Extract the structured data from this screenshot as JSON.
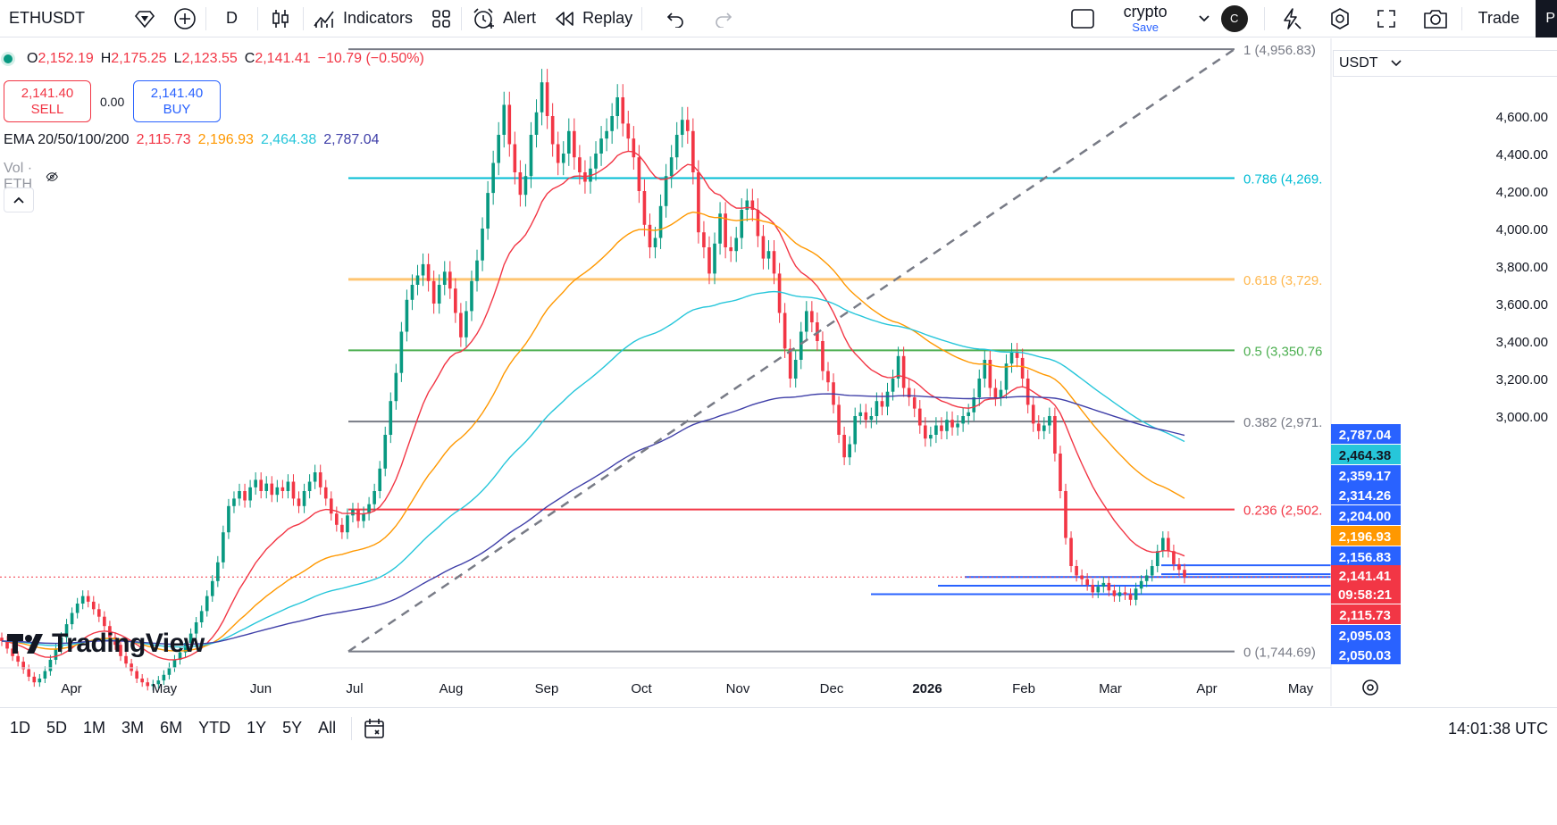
{
  "toolbar": {
    "symbol": "ETHUSDT",
    "interval": "D",
    "indicators_label": "Indicators",
    "alert_label": "Alert",
    "replay_label": "Replay",
    "workspace_name": "crypto",
    "workspace_save": "Save",
    "avatar_letter": "C",
    "trade_label": "Trade",
    "p_label": "P"
  },
  "legend": {
    "open_key": "O",
    "open": "2,152.19",
    "high_key": "H",
    "high": "2,175.25",
    "low_key": "L",
    "low": "2,123.55",
    "close_key": "C",
    "close": "2,141.41",
    "change": "−10.79 (−0.50%)",
    "sell_price": "2,141.40",
    "sell_label": "SELL",
    "spread": "0.00",
    "buy_price": "2,141.40",
    "buy_label": "BUY",
    "ema_label": "EMA 20/50/100/200",
    "ema_values": [
      "2,115.73",
      "2,196.93",
      "2,464.38",
      "2,787.04"
    ],
    "vol_label": "Vol · ETH"
  },
  "currency": "USDT",
  "logo_text": "TradingView",
  "bottombar": {
    "ranges": [
      "1D",
      "5D",
      "1M",
      "3M",
      "6M",
      "YTD",
      "1Y",
      "5Y",
      "All"
    ],
    "time": "14:01:38 UTC"
  },
  "colors": {
    "ema20": "#f23645",
    "ema50": "#ff9800",
    "ema100": "#26c6da",
    "ema200": "#3f3fa8",
    "up": "#089981",
    "down": "#f23645",
    "fib_0": "#787b86",
    "fib_236": "#f23645",
    "fib_382": "#787b86",
    "fib_5": "#4caf50",
    "fib_618": "#ffb74d",
    "fib_786": "#00bcd4",
    "fib_1": "#787b86",
    "hline": "#2962ff"
  },
  "chart_data": {
    "type": "candlestick",
    "symbol": "ETHUSDT",
    "interval": "1D",
    "price_ticks": [
      "4,600.00",
      "4,400.00",
      "4,200.00",
      "4,000.00",
      "3,800.00",
      "3,600.00",
      "3,400.00",
      "3,200.00",
      "3,000.00"
    ],
    "time_ticks": [
      "Apr",
      "May",
      "Jun",
      "Jul",
      "Aug",
      "Sep",
      "Oct",
      "Nov",
      "Dec",
      "2026",
      "Feb",
      "Mar",
      "Apr",
      "May"
    ],
    "fib_levels": [
      {
        "level": 1,
        "price": 4956.83,
        "label": "1 (4,956.83)"
      },
      {
        "level": 0.786,
        "price": 4269,
        "label": "0.786 (4,269."
      },
      {
        "level": 0.618,
        "price": 3729,
        "label": "0.618 (3,729."
      },
      {
        "level": 0.5,
        "price": 3350.76,
        "label": "0.5 (3,350.76"
      },
      {
        "level": 0.382,
        "price": 2971,
        "label": "0.382 (2,971."
      },
      {
        "level": 0.236,
        "price": 2502,
        "label": "0.236 (2,502."
      },
      {
        "level": 0,
        "price": 1744.69,
        "label": "0 (1,744.69)"
      }
    ],
    "price_labels": [
      {
        "price": 2787.04,
        "text": "2,787.04",
        "color": "#2962ff"
      },
      {
        "price": 2464.38,
        "text": "2,464.38",
        "color": "#26c6da"
      },
      {
        "price": 2359.17,
        "text": "2,359.17",
        "color": "#2962ff"
      },
      {
        "price": 2314.26,
        "text": "2,314.26",
        "color": "#2962ff"
      },
      {
        "price": 2204.0,
        "text": "2,204.00",
        "color": "#2962ff"
      },
      {
        "price": 2196.93,
        "text": "2,196.93",
        "color": "#ff9800"
      },
      {
        "price": 2156.83,
        "text": "2,156.83",
        "color": "#2962ff"
      },
      {
        "price": 2141.41,
        "text": "2,141.41",
        "color": "#f23645"
      },
      {
        "price": 2141.41,
        "text": "09:58:21",
        "color": "#f23645"
      },
      {
        "price": 2115.73,
        "text": "2,115.73",
        "color": "#f23645"
      },
      {
        "price": 2095.03,
        "text": "2,095.03",
        "color": "#2962ff"
      },
      {
        "price": 2050.03,
        "text": "2,050.03",
        "color": "#2962ff"
      }
    ],
    "horizontal_lines": [
      2204.0,
      2156.83,
      2141.41,
      2095.03,
      2050.03
    ],
    "ema_series": [
      {
        "name": "EMA 20",
        "last": 2115.73
      },
      {
        "name": "EMA 50",
        "last": 2196.93
      },
      {
        "name": "EMA 100",
        "last": 2464.38
      },
      {
        "name": "EMA 200",
        "last": 2787.04
      }
    ],
    "candles_close": [
      1800,
      1760,
      1720,
      1690,
      1650,
      1610,
      1580,
      1600,
      1640,
      1700,
      1760,
      1820,
      1890,
      1950,
      2000,
      2040,
      2010,
      1970,
      1930,
      1880,
      1820,
      1780,
      1720,
      1680,
      1640,
      1600,
      1580,
      1560,
      1570,
      1590,
      1620,
      1660,
      1700,
      1740,
      1790,
      1840,
      1900,
      1960,
      2040,
      2120,
      2220,
      2380,
      2520,
      2560,
      2600,
      2550,
      2620,
      2660,
      2600,
      2640,
      2580,
      2620,
      2600,
      2650,
      2560,
      2520,
      2600,
      2650,
      2700,
      2620,
      2560,
      2480,
      2420,
      2380,
      2470,
      2500,
      2440,
      2480,
      2530,
      2600,
      2720,
      2900,
      3080,
      3230,
      3450,
      3620,
      3700,
      3750,
      3810,
      3720,
      3600,
      3700,
      3770,
      3680,
      3550,
      3420,
      3560,
      3720,
      3830,
      4000,
      4190,
      4350,
      4500,
      4660,
      4450,
      4300,
      4180,
      4280,
      4500,
      4620,
      4780,
      4600,
      4450,
      4350,
      4400,
      4520,
      4380,
      4300,
      4250,
      4320,
      4400,
      4480,
      4520,
      4600,
      4700,
      4560,
      4480,
      4380,
      4200,
      4020,
      3900,
      3950,
      4120,
      4280,
      4380,
      4500,
      4580,
      4520,
      4300,
      3980,
      3900,
      3760,
      3920,
      4080,
      3900,
      3880,
      3950,
      4100,
      4150,
      4100,
      3960,
      3840,
      3880,
      3760,
      3550,
      3360,
      3200,
      3300,
      3450,
      3560,
      3500,
      3400,
      3240,
      3180,
      3060,
      2900,
      2780,
      2850,
      3000,
      3020,
      2980,
      3000,
      3080,
      3050,
      3130,
      3200,
      3320,
      3150,
      3100,
      3040,
      2950,
      2880,
      2900,
      2950,
      2920,
      2980,
      2940,
      2960,
      3000,
      3020,
      3100,
      3200,
      3300,
      3150,
      3100,
      3140,
      3280,
      3340,
      3310,
      3200,
      3060,
      2960,
      2920,
      2950,
      3000,
      2800,
      2600,
      2350,
      2200,
      2150,
      2130,
      2100,
      2060,
      2090,
      2110,
      2070,
      2040,
      2060,
      2050,
      2020,
      2080,
      2120,
      2150,
      2200,
      2280,
      2350,
      2280,
      2210,
      2180,
      2140
    ],
    "ylim": [
      1700,
      5000
    ]
  }
}
